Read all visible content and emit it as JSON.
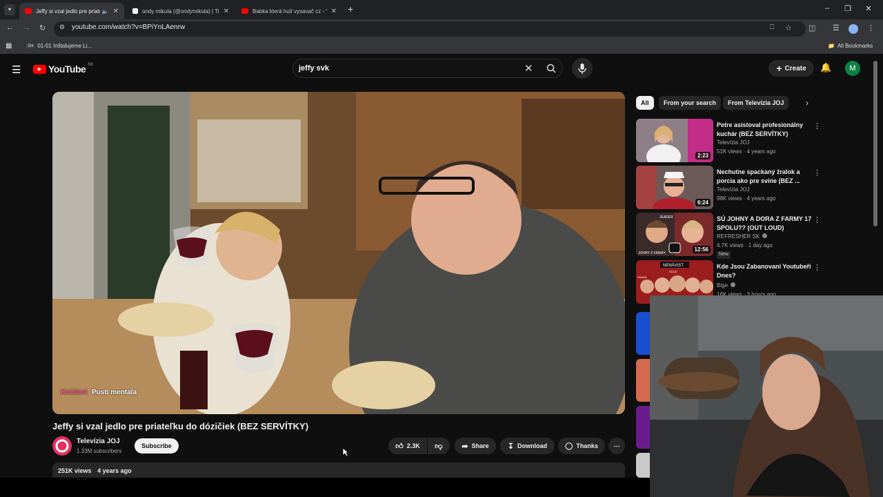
{
  "browser": {
    "tabs": [
      {
        "title": "Jeffy si vzal jedlo pre priateľku do dóziciek",
        "fav_color": "#ff0000"
      },
      {
        "title": "ondy mikula (@ondymikula) | TikTok",
        "fav_color": "#ffffff"
      },
      {
        "title": "Babka která hulí vysavač cz - YouTube",
        "fav_color": "#ff0000"
      }
    ],
    "new_tab": "+",
    "url": "youtube.com/watch?v=BPiYnLAenrw",
    "bookmark": "01-01 Inštalujeme Li...",
    "bookmark_badge": "SH",
    "all_bookmarks": "All Bookmarks"
  },
  "youtube": {
    "logo": "YouTube",
    "region": "SK",
    "search_value": "jeffy svk",
    "create_label": "Create",
    "avatar_letter": "M"
  },
  "video": {
    "caption_tag": "Kn1Gu4",
    "caption_text": "Pusti mentala",
    "title": "Jeffy si vzal jedlo pre priateľku do dózičiek (BEZ SERVÍTKY)",
    "channel": "Televízia JOJ",
    "subscribers": "1.33M subscribers",
    "subscribe_label": "Subscribe",
    "likes": "2.3K",
    "share_label": "Share",
    "download_label": "Download",
    "thanks_label": "Thanks",
    "views": "251K views",
    "age": "4 years ago"
  },
  "chips": [
    "All",
    "From your search",
    "From Televízia JOJ"
  ],
  "related": [
    {
      "title": "Petre asistoval profesionálny kuchár (BEZ SERVÍTKY)",
      "channel": "Televízia JOJ",
      "meta": "51K views · 4 years ago",
      "duration": "2:23",
      "verified": false
    },
    {
      "title": "Nechutne spackaný žralok a porcia ako pre svine (BEZ ...",
      "channel": "Televízia JOJ",
      "meta": "98K views · 4 years ago",
      "duration": "6:24",
      "verified": false
    },
    {
      "title": "SÚ JOHNY A DORA Z FARMY 17 SPOLU?? (OUT LOUD)",
      "channel": "REFRESHER SK",
      "meta": "4.7K views · 1 day ago",
      "duration": "12:56",
      "verified": true,
      "badge": "New"
    },
    {
      "title": "Kde Jsou Zabanovaní Youtubeři Dnes?",
      "channel": "Bige",
      "meta": "16K views · 3 hours ago",
      "duration": "",
      "verified": true
    }
  ],
  "thumb_text": {
    "t3_left": "JOHNY Z FARMY",
    "t3_top": "JEADER",
    "t4_top": "NENÁVIST",
    "t4_labels": [
      "ZRADA",
      "SOUD"
    ]
  },
  "colors": {
    "bg": "#0f0f0f",
    "yt_red": "#ff0000",
    "joj_pink": "#e62e63"
  }
}
